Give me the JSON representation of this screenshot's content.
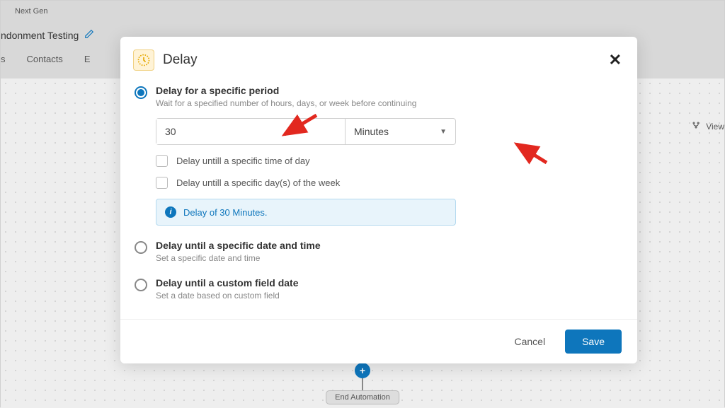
{
  "background": {
    "badge": "Next Gen",
    "page_title_fragment": "ndonment Testing",
    "tabs": [
      "s",
      "Contacts",
      "E"
    ],
    "view_label": "View",
    "end_node_label": "End Automation",
    "node_symbol": "+"
  },
  "modal": {
    "title": "Delay",
    "options": {
      "period": {
        "title": "Delay for a specific period",
        "desc": "Wait for a specified number of hours, days, or week before continuing",
        "value": "30",
        "unit": "Minutes",
        "checkbox_time_of_day": "Delay untill a specific time of day",
        "checkbox_day_of_week": "Delay untill a specific day(s) of the week",
        "info_text": "Delay of 30 Minutes."
      },
      "date_time": {
        "title": "Delay until a specific date and time",
        "desc": "Set a specific date and time"
      },
      "custom_field": {
        "title": "Delay until a custom field date",
        "desc": "Set a date based on custom field"
      }
    },
    "footer": {
      "cancel": "Cancel",
      "save": "Save"
    }
  }
}
